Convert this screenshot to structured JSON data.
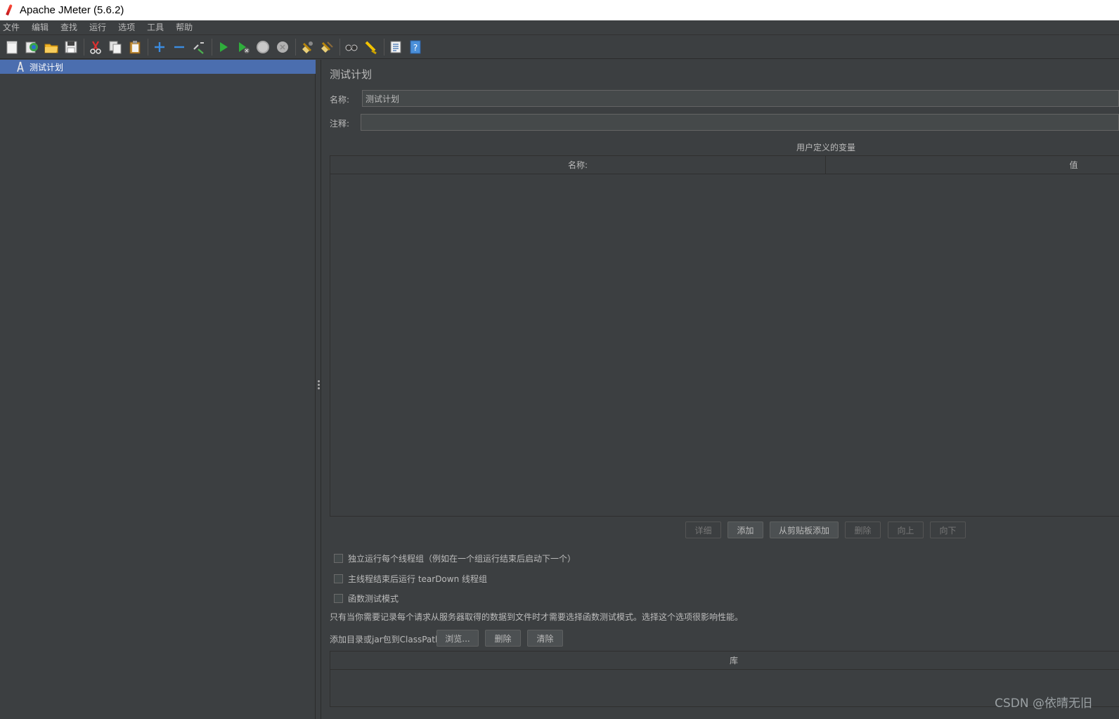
{
  "window": {
    "title": "Apache JMeter (5.6.2)"
  },
  "menu": [
    "文件",
    "编辑",
    "查找",
    "运行",
    "选项",
    "工具",
    "帮助"
  ],
  "toolbar": {
    "icons": [
      "new-icon",
      "templates-icon",
      "open-icon",
      "save-icon",
      "cut-icon",
      "copy-icon",
      "paste-icon",
      "expand-icon",
      "collapse-icon",
      "toggle-icon",
      "start-icon",
      "start-no-pause-icon",
      "stop-icon",
      "shutdown-icon",
      "clear-icon",
      "clear-all-icon",
      "search-icon",
      "reset-search-icon",
      "function-helper-icon",
      "help-icon"
    ]
  },
  "tree": {
    "selected": "测试计划"
  },
  "panel": {
    "title": "测试计划",
    "name_label": "名称:",
    "name_value": "测试计划",
    "comment_label": "注释:",
    "comment_value": "",
    "vars_title": "用户定义的变量",
    "vars_columns": [
      "名称:",
      "值"
    ],
    "vars_buttons": [
      {
        "label": "详细",
        "enabled": false
      },
      {
        "label": "添加",
        "enabled": true
      },
      {
        "label": "从剪贴板添加",
        "enabled": true
      },
      {
        "label": "删除",
        "enabled": false
      },
      {
        "label": "向上",
        "enabled": false
      },
      {
        "label": "向下",
        "enabled": false
      }
    ],
    "checkboxes": [
      {
        "label": "独立运行每个线程组（例如在一个组运行结束后启动下一个）",
        "checked": false
      },
      {
        "label": "主线程结束后运行 tearDown 线程组",
        "checked": false
      },
      {
        "label": "函数测试模式",
        "checked": false
      }
    ],
    "functional_note": "只有当你需要记录每个请求从服务器取得的数据到文件时才需要选择函数测试模式。选择这个选项很影响性能。",
    "classpath_label": "添加目录或jar包到ClassPath",
    "classpath_buttons": [
      "浏览...",
      "删除",
      "清除"
    ],
    "lib_column": "库"
  },
  "watermark": "CSDN @依晴无旧",
  "colors": {
    "background": "#3c3f41",
    "selection": "#4b6eaf",
    "text": "#bbbbbb"
  }
}
